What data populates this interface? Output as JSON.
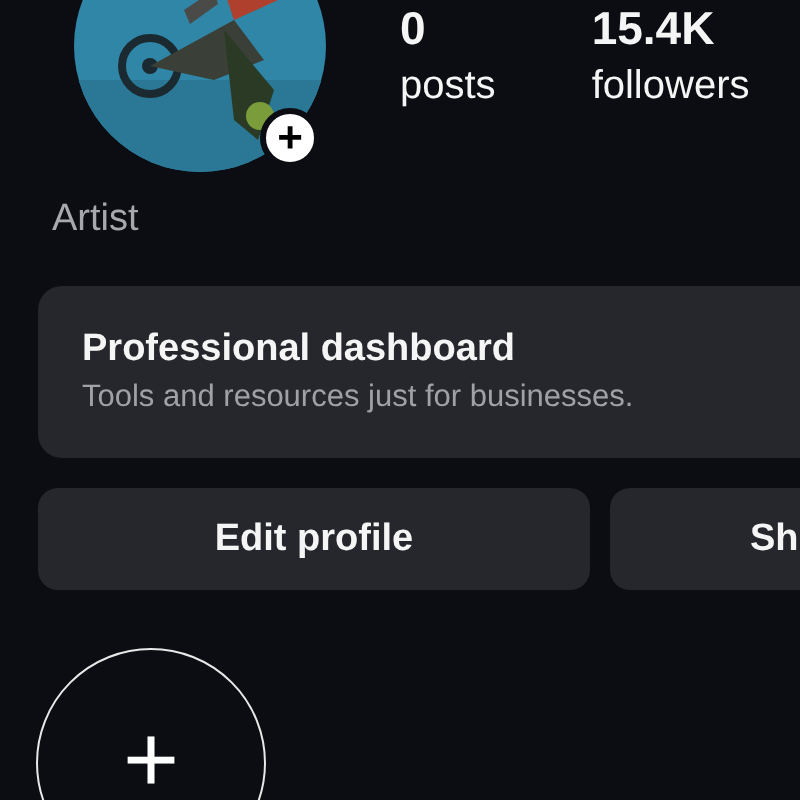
{
  "profile": {
    "add_story_icon": "+"
  },
  "stats": [
    {
      "value": "0",
      "label": "posts"
    },
    {
      "value": "15.4K",
      "label": "followers"
    }
  ],
  "category": "Artist",
  "dashboard": {
    "title": "Professional dashboard",
    "subtitle": "Tools and resources just for businesses."
  },
  "buttons": [
    {
      "label": "Edit profile"
    },
    {
      "label": "Sh"
    }
  ],
  "new_highlight": {
    "icon": "+"
  }
}
